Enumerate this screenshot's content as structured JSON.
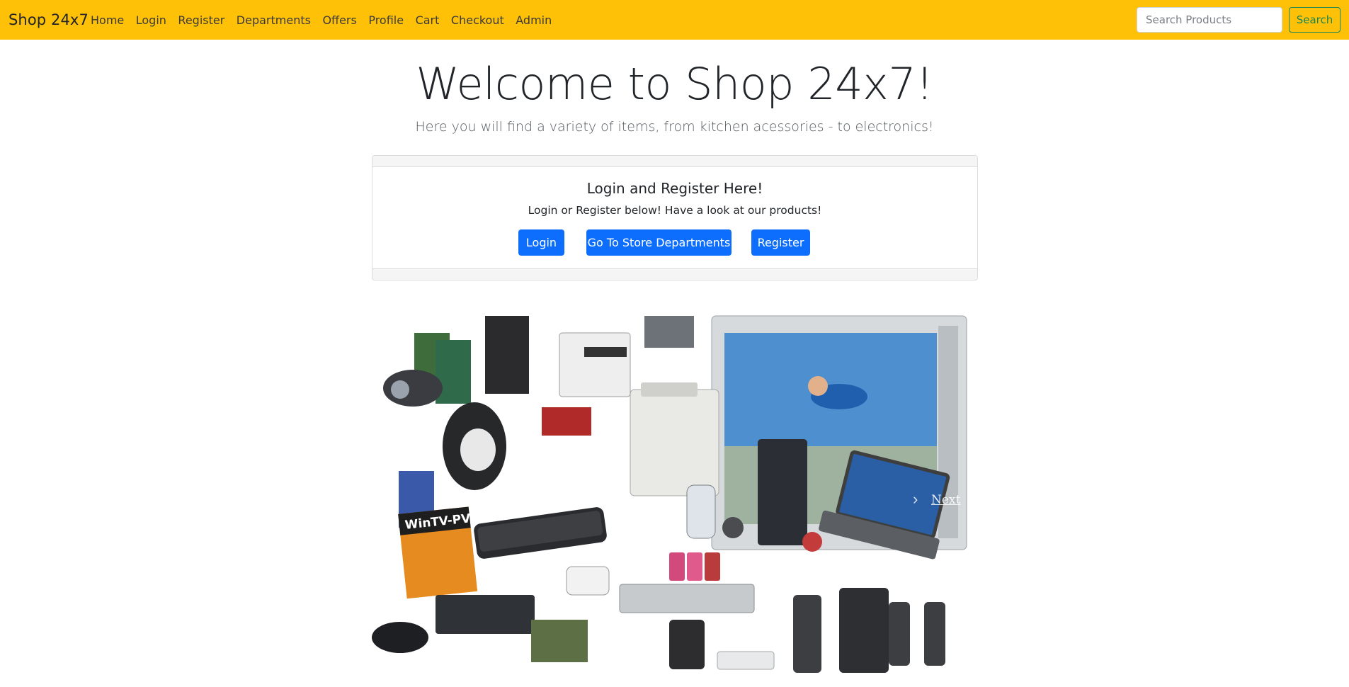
{
  "navbar": {
    "brand": "Shop 24x7",
    "links": [
      "Home",
      "Login",
      "Register",
      "Departments",
      "Offers",
      "Profile",
      "Cart",
      "Checkout",
      "Admin"
    ],
    "search_placeholder": "Search Products",
    "search_button": "Search",
    "background": "#ffc107"
  },
  "hero": {
    "title": "Welcome to Shop 24x7!",
    "subtitle": "Here you will find a variety of items, from kitchen acessories - to electronics!"
  },
  "card": {
    "title": "Login and Register Here!",
    "text": "Login or Register below! Have a look at our products!",
    "buttons": {
      "login": "Login",
      "departments": "Go To Store Departments",
      "register": "Register"
    },
    "button_color": "#0d6efd"
  },
  "carousel": {
    "next_label": "Next",
    "screen_label": "WinTV-PVR"
  }
}
